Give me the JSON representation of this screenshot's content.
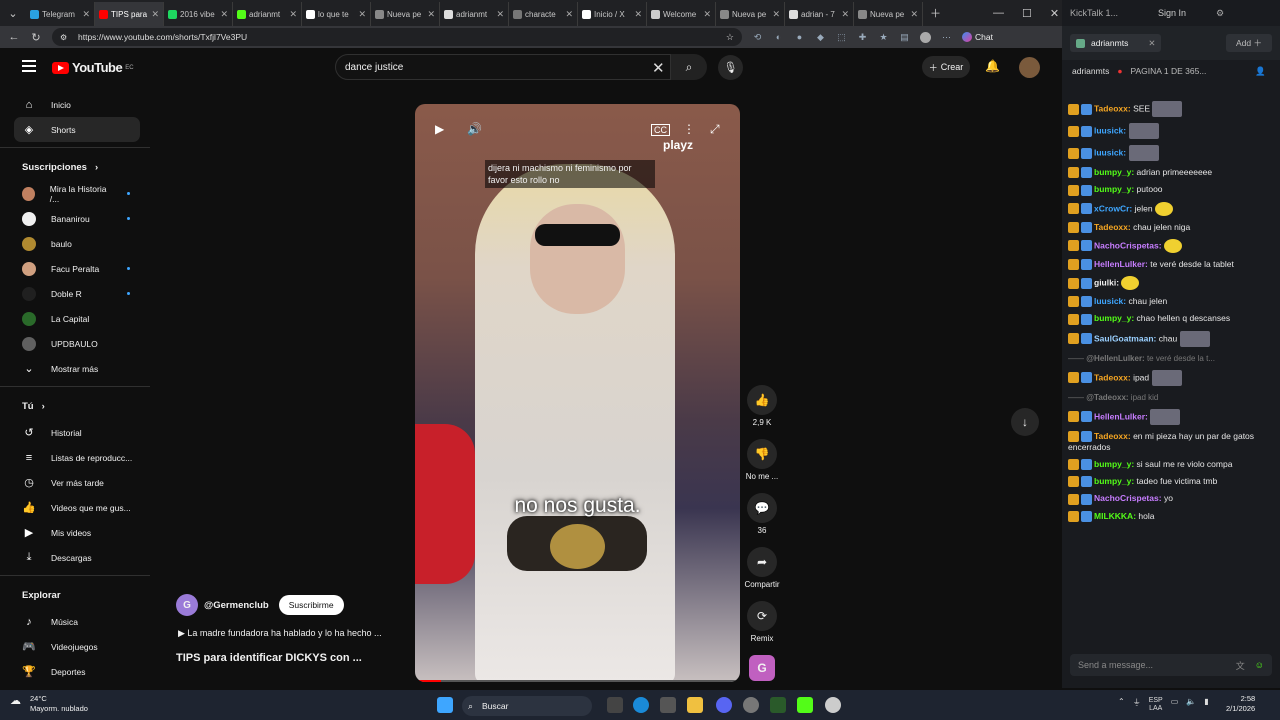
{
  "browser": {
    "tabs": [
      {
        "label": "Telegram",
        "color": "#2aa1e0",
        "active": false
      },
      {
        "label": "TIPS para",
        "color": "#ff0000",
        "active": true
      },
      {
        "label": "2016 vibe",
        "color": "#1ed760",
        "active": false
      },
      {
        "label": "adrianmt",
        "color": "#53fc18",
        "active": false
      },
      {
        "label": "lo que te",
        "color": "#ffffff",
        "active": false
      },
      {
        "label": "Nueva pe",
        "color": "#888888",
        "active": false
      },
      {
        "label": "adrianmt",
        "color": "#dddddd",
        "active": false
      },
      {
        "label": "characte",
        "color": "#777777",
        "active": false
      },
      {
        "label": "Inicio / X",
        "color": "#ffffff",
        "active": false
      },
      {
        "label": "Welcome",
        "color": "#cccccc",
        "active": false
      },
      {
        "label": "Nueva pe",
        "color": "#888888",
        "active": false
      },
      {
        "label": "adrian - 7",
        "color": "#dddddd",
        "active": false
      },
      {
        "label": "Nueva pe",
        "color": "#888888",
        "active": false
      }
    ],
    "url": "https://www.youtube.com/shorts/Txfjl7Ve3PU",
    "chat_label": "Chat"
  },
  "youtube": {
    "logo": "YouTube",
    "logo_region": "EC",
    "search_value": "dance justice",
    "create_label": "Crear",
    "nav": {
      "home": "Inicio",
      "shorts": "Shorts",
      "subscriptions": "Suscripciones",
      "channels": [
        {
          "name": "Mira la Historia /...",
          "color": "#c08060"
        },
        {
          "name": "Bananirou",
          "color": "#f0f0f0"
        },
        {
          "name": "baulo",
          "color": "#b08a30"
        },
        {
          "name": "Facu Peralta",
          "color": "#d0a080"
        },
        {
          "name": "Doble R",
          "color": "#202020"
        },
        {
          "name": "La Capital",
          "color": "#2a6a2a"
        },
        {
          "name": "UPDBAULO",
          "color": "#606060"
        }
      ],
      "show_more": "Mostrar más",
      "you": "Tú",
      "you_items": [
        "Historial",
        "Listas de reproducc...",
        "Ver más tarde",
        "Videos que me gus...",
        "Mis videos",
        "Descargas"
      ],
      "explore": "Explorar",
      "explore_items": [
        "Música",
        "Videojuegos",
        "Deportes"
      ]
    },
    "short": {
      "caption_top": "dijera ni machismo ni feminismo por favor esto rollo no",
      "caption_big": "no nos gusta.",
      "watermark": "playz",
      "likes": "2,9 K",
      "dislike_label": "No me ...",
      "comments": "36",
      "share_label": "Compartir",
      "remix_label": "Remix",
      "channel": "@Germenclub",
      "subscribe": "Suscribirme",
      "description": "La madre fundadora ha hablado y lo ha hecho ...",
      "title": "TIPS para identificar DICKYS con ...",
      "channel_badge": "G",
      "progress_fraction": 0.08
    }
  },
  "kick": {
    "app_title": "KickTalk 1...",
    "sign_in": "Sign In",
    "tab_label": "adrianmts",
    "add_label": "Add",
    "channel": "adrianmts",
    "pagination": "PAGINA 1 DE 365...",
    "send_placeholder": "Send a message...",
    "messages": [
      {
        "user": "Tadeoxx:",
        "text": "SEE",
        "color": "#f5a623",
        "emote": true,
        "reply": false
      },
      {
        "user": "luusick:",
        "text": "",
        "color": "#3ea6ff",
        "emote": true,
        "reply": false
      },
      {
        "user": "luusick:",
        "text": "",
        "color": "#3ea6ff",
        "emote": true,
        "reply": false
      },
      {
        "user": "bumpy_y:",
        "text": "adrian primeeeeeee",
        "color": "#53fc18",
        "emote": false,
        "reply": false
      },
      {
        "user": "bumpy_y:",
        "text": "putooo",
        "color": "#53fc18",
        "emote": false,
        "reply": false
      },
      {
        "user": "xCrowCr:",
        "text": "jelen",
        "color": "#3ea6ff",
        "emote": false,
        "smile": true,
        "reply": false
      },
      {
        "user": "Tadeoxx:",
        "text": "chau jelen niga",
        "color": "#f5a623",
        "emote": false,
        "reply": false
      },
      {
        "user": "NachoCrispetas:",
        "text": "",
        "color": "#c77dff",
        "emote": false,
        "smile": true,
        "reply": false
      },
      {
        "user": "HellenLulker:",
        "text": "te veré desde la tablet",
        "color": "#c77dff",
        "emote": false,
        "reply": false
      },
      {
        "user": "giulki:",
        "text": "",
        "color": "#f0f0f0",
        "emote": false,
        "smile": true,
        "reply": false
      },
      {
        "user": "luusick:",
        "text": "chau jelen",
        "color": "#3ea6ff",
        "emote": false,
        "reply": false
      },
      {
        "user": "bumpy_y:",
        "text": "chao hellen q descanses",
        "color": "#53fc18",
        "emote": false,
        "reply": false
      },
      {
        "user": "SaulGoatmaan:",
        "text": "chau",
        "color": "#9ad0ff",
        "emote": true,
        "reply": false
      },
      {
        "user": "@HellenLulker:",
        "text": "te veré desde la t...",
        "color": "#777777",
        "emote": false,
        "reply": true
      },
      {
        "user": "Tadeoxx:",
        "text": "ipad",
        "color": "#f5a623",
        "emote": true,
        "reply": false
      },
      {
        "user": "@Tadeoxx:",
        "text": "ipad kid",
        "color": "#777777",
        "emote": false,
        "reply": true
      },
      {
        "user": "HellenLulker:",
        "text": "",
        "color": "#c77dff",
        "emote": true,
        "reply": false
      },
      {
        "user": "Tadeoxx:",
        "text": "en mi pieza hay un par de gatos encerrados",
        "color": "#f5a623",
        "emote": false,
        "reply": false
      },
      {
        "user": "bumpy_y:",
        "text": "si saul me re violo compa",
        "color": "#53fc18",
        "emote": false,
        "reply": false
      },
      {
        "user": "bumpy_y:",
        "text": "tadeo fue victima tmb",
        "color": "#53fc18",
        "emote": false,
        "reply": false
      },
      {
        "user": "NachoCrispetas:",
        "text": "yo",
        "color": "#c77dff",
        "emote": false,
        "reply": false
      },
      {
        "user": "MILKKKA:",
        "text": "hola",
        "color": "#53fc18",
        "emote": false,
        "reply": false
      }
    ]
  },
  "taskbar": {
    "temperature": "24°C",
    "weather": "Mayorm. nublado",
    "search": "Buscar",
    "lang": "ESP",
    "layout": "LAA",
    "time": "2:58",
    "date": "2/1/2026"
  }
}
